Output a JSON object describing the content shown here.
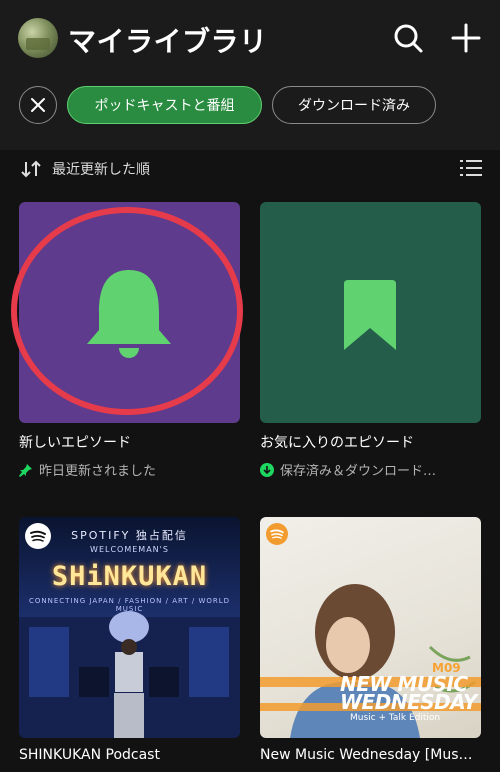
{
  "header": {
    "title": "マイライブラリ",
    "icons": {
      "search": "search-icon",
      "add": "plus-icon",
      "avatar": "avatar"
    }
  },
  "filters": {
    "clear_icon": "close-icon",
    "chips": [
      {
        "label": "ポッドキャストと番組",
        "selected": true
      },
      {
        "label": "ダウンロード済み",
        "selected": false
      }
    ]
  },
  "sort": {
    "label": "最近更新した順",
    "icon": "sort-arrows-icon",
    "view_icon": "list-view-icon"
  },
  "tiles": [
    {
      "title": "新しいエピソード",
      "subtitle": "昨日更新されました",
      "sub_icon": "pin-icon",
      "art_icon": "bell-icon",
      "color": "#5e3b8c"
    },
    {
      "title": "お気に入りのエピソード",
      "subtitle": "保存済み＆ダウンロード…",
      "sub_icon": "download-icon",
      "art_icon": "bookmark-icon",
      "color": "#245e4b"
    },
    {
      "title": "SHINKUKAN Podcast",
      "art_text": {
        "top": "SPOTIFY 独占配信",
        "mid": "WELCOMEMAN'S",
        "big": "SHiNKUKAN",
        "sub": "CONNECTING JAPAN / FASHION / ART / WORLD MUSIC"
      }
    },
    {
      "title": "New Music Wednesday [Mus…",
      "art_text": {
        "num": "M09",
        "big1": "NEW MUSIC",
        "big2": "WEDNESDAY",
        "small": "Music + Talk Edition"
      }
    }
  ],
  "colors": {
    "accent": "#1ed760",
    "chip_selected": "#2a8c41",
    "highlight_ring": "#e53b4b",
    "icon_green": "#60d26f"
  }
}
